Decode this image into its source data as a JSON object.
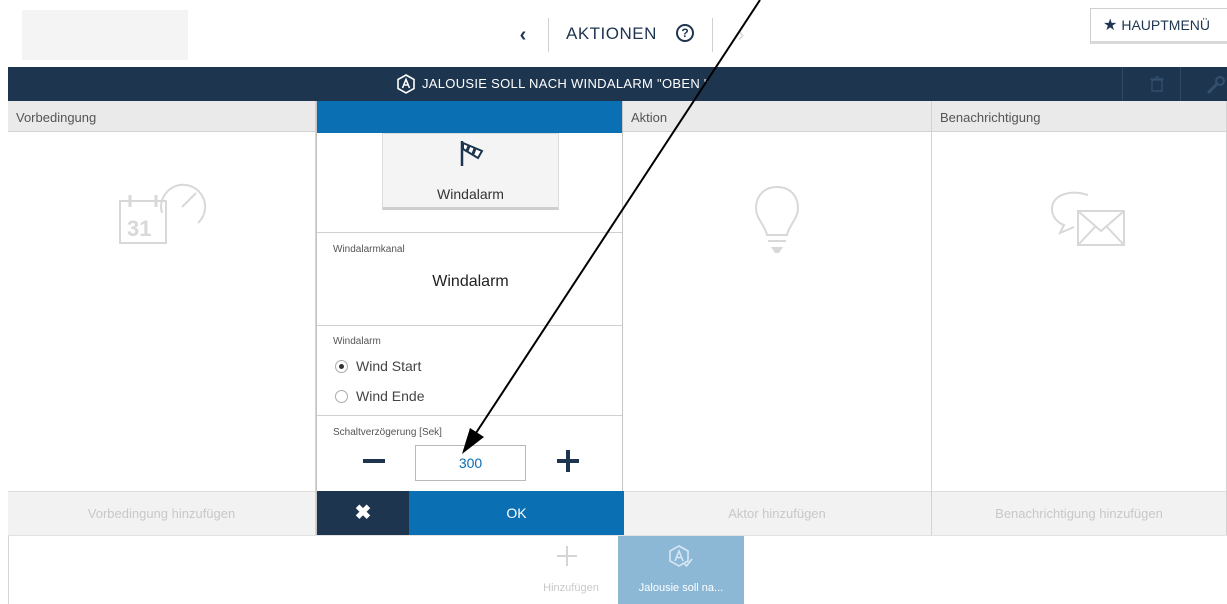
{
  "nav": {
    "back_icon": "chevron-left-icon",
    "title": "AKTIONEN",
    "help_icon": "question-circle-icon",
    "main_menu_label": "HAUPTMENÜ",
    "main_menu_icon": "star-icon"
  },
  "titlebar": {
    "icon": "automation-a-icon",
    "title": "JALOUSIE SOLL NACH WINDALARM \"OBEN \"",
    "delete_icon": "trash-icon",
    "settings_icon": "wrench-icon"
  },
  "columns": {
    "precondition": {
      "header": "Vorbedingung",
      "icon": "calendar-clock-icon",
      "footer": "Vorbedingung hinzufügen"
    },
    "action": {
      "header": "Aktion",
      "icon": "lightbulb-icon",
      "footer": "Aktor hinzufügen"
    },
    "notification": {
      "header": "Benachrichtigung",
      "icon": "chat-mail-icon",
      "footer": "Benachrichtigung hinzufügen"
    }
  },
  "editor": {
    "trigger_label": "Windalarm",
    "trigger_icon": "windsock-icon",
    "channel_label": "Windalarmkanal",
    "channel_value": "Windalarm",
    "alarm_label": "Windalarm",
    "options": [
      {
        "label": "Wind Start",
        "checked": true
      },
      {
        "label": "Wind Ende",
        "checked": false
      }
    ],
    "delay_label": "Schaltverzögerung [Sek]",
    "delay_value": "300",
    "cancel_icon": "close-icon",
    "ok_label": "OK"
  },
  "bottom": {
    "add_label": "Hinzufügen",
    "action_tile_label": "Jalousie soll na..."
  },
  "colors": {
    "navy": "#1e3550",
    "accent_blue": "#0a6fb3",
    "tile_blue": "#8cb8d6"
  }
}
